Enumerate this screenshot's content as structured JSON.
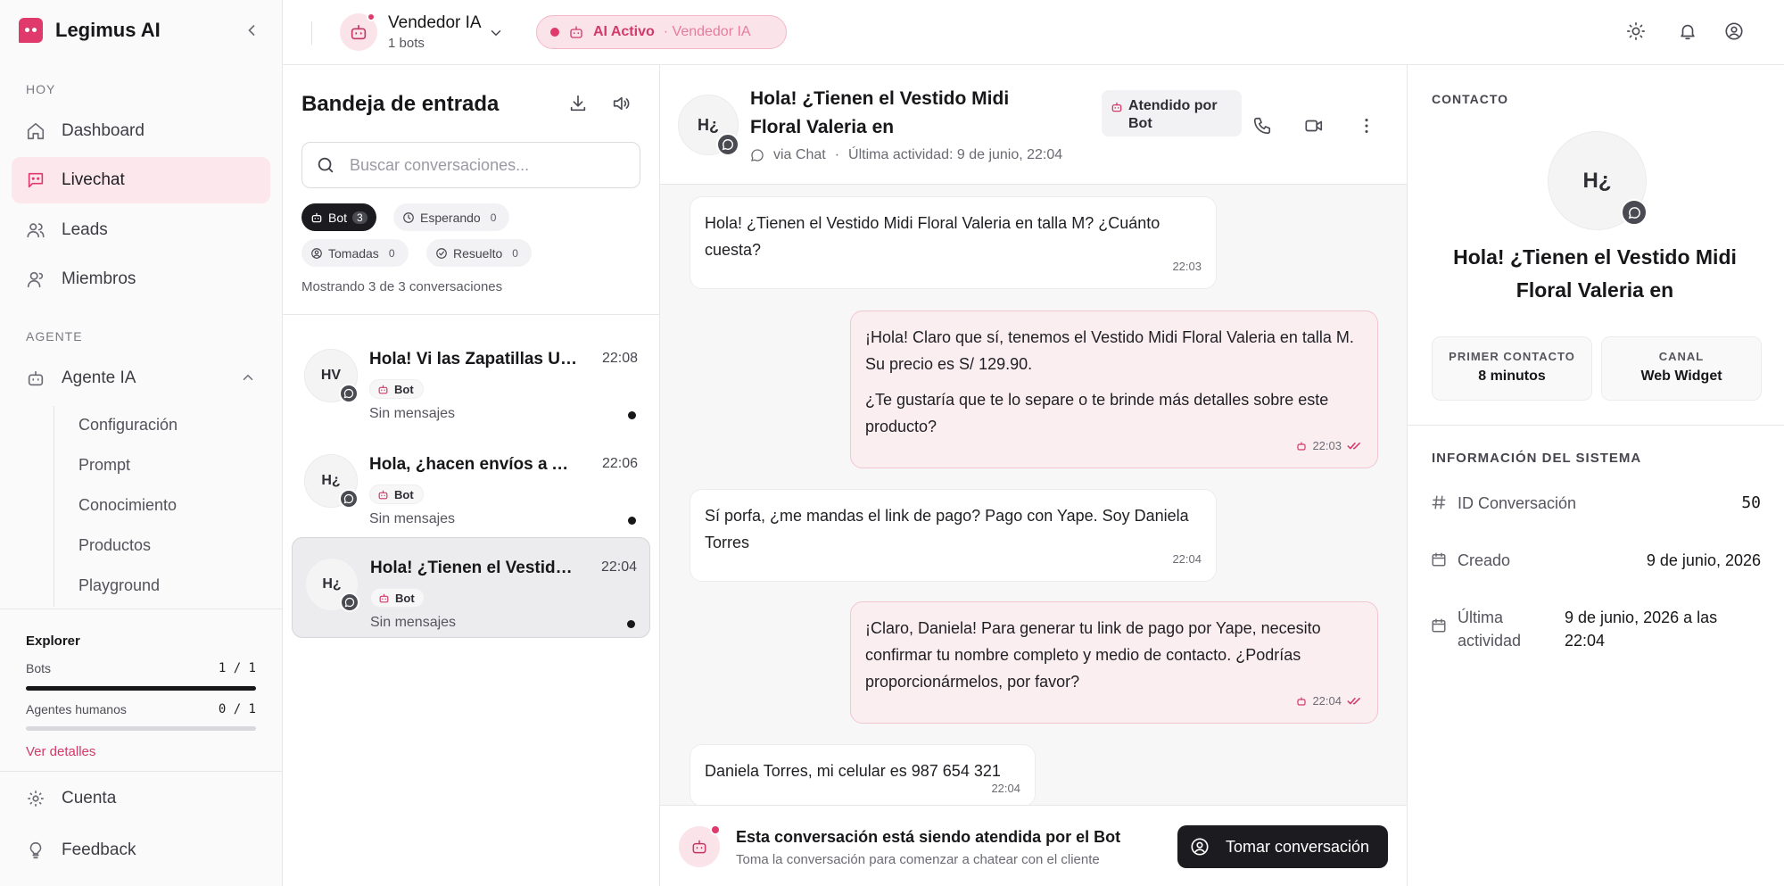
{
  "app": {
    "name": "Legimus AI"
  },
  "sidebar": {
    "section_today": "HOY",
    "nav": [
      {
        "label": "Dashboard",
        "icon": "home-icon"
      },
      {
        "label": "Livechat",
        "icon": "chat-icon",
        "active": true
      },
      {
        "label": "Leads",
        "icon": "users-icon"
      },
      {
        "label": "Miembros",
        "icon": "members-icon"
      }
    ],
    "section_agent": "AGENTE",
    "agent_label": "Agente IA",
    "agent_sub": [
      "Configuración",
      "Prompt",
      "Conocimiento",
      "Productos",
      "Playground"
    ],
    "explorer": {
      "title": "Explorer",
      "bots_label": "Bots",
      "bots_value": "1 / 1",
      "bots_fill": 1.0,
      "humans_label": "Agentes humanos",
      "humans_value": "0 / 1",
      "humans_fill": 0.0,
      "details_link": "Ver detalles"
    },
    "account": "Cuenta",
    "feedback": "Feedback"
  },
  "topbar": {
    "bot_name": "Vendedor IA",
    "bot_count": "1 bots",
    "ai_status": "AI Activo",
    "ai_status_sub": "· Vendedor IA"
  },
  "inbox": {
    "title": "Bandeja de entrada",
    "search_placeholder": "Buscar conversaciones...",
    "filters": [
      {
        "label": "Bot",
        "count": "3",
        "active": true
      },
      {
        "label": "Esperando",
        "count": "0"
      },
      {
        "label": "Tomadas",
        "count": "0"
      },
      {
        "label": "Resuelto",
        "count": "0"
      }
    ],
    "showing": "Mostrando 3 de 3 conversaciones",
    "conversations": [
      {
        "initials": "HV",
        "title": "Hola! Vi las Zapatillas Urbanas",
        "time": "22:08",
        "tag": "Bot",
        "preview": "Sin mensajes"
      },
      {
        "initials": "H¿",
        "title": "Hola, ¿hacen envíos a Arequipa?",
        "time": "22:06",
        "tag": "Bot",
        "preview": "Sin mensajes"
      },
      {
        "initials": "H¿",
        "title": "Hola! ¿Tienen el Vestido Midi",
        "time": "22:04",
        "tag": "Bot",
        "preview": "Sin mensajes",
        "selected": true
      }
    ]
  },
  "chat": {
    "initials": "H¿",
    "title": "Hola! ¿Tienen el Vestido Midi Floral Valeria en",
    "channel": "via Chat",
    "last_activity": "Última actividad: 9 de junio, 22:04",
    "attended_by": "Atendido por Bot",
    "messages": [
      {
        "dir": "in",
        "paras": [
          "Hola! ¿Tienen el Vestido Midi Floral Valeria en talla M? ¿Cuánto cuesta?"
        ],
        "time": "22:03"
      },
      {
        "dir": "out",
        "paras": [
          "¡Hola! Claro que sí, tenemos el Vestido Midi Floral Valeria en talla M. Su precio es S/ 129.90.",
          "¿Te gustaría que te lo separe o te brinde más detalles sobre este producto?"
        ],
        "time": "22:03"
      },
      {
        "dir": "in",
        "paras": [
          "Sí porfa, ¿me mandas el link de pago? Pago con Yape. Soy Daniela Torres"
        ],
        "time": "22:04"
      },
      {
        "dir": "out",
        "paras": [
          "¡Claro, Daniela! Para generar tu link de pago por Yape, necesito confirmar tu nombre completo y medio de contacto. ¿Podrías proporcionármelos, por favor?"
        ],
        "time": "22:04"
      },
      {
        "dir": "in",
        "paras": [
          "Daniela Torres, mi celular es 987 654 321"
        ],
        "time": "22:04"
      }
    ],
    "footer_title": "Esta conversación está siendo atendida por el Bot",
    "footer_sub": "Toma la conversación para comenzar a chatear con el cliente",
    "take_button": "Tomar conversación"
  },
  "contact": {
    "section": "CONTACTO",
    "initials": "H¿",
    "name": "Hola! ¿Tienen el Vestido Midi Floral Valeria en",
    "first_contact_label": "PRIMER CONTACTO",
    "first_contact_value": "8 minutos",
    "channel_label": "CANAL",
    "channel_value": "Web Widget",
    "system_section": "INFORMACIÓN DEL SISTEMA",
    "id_label": "ID Conversación",
    "id_value": "50",
    "created_label": "Creado",
    "created_value": "9 de junio, 2026",
    "last_label": "Última actividad",
    "last_value": "9 de junio, 2026 a las 22:04"
  },
  "colors": {
    "accent": "#e0396b",
    "accent_soft": "#fbe7ec",
    "dark": "#1c1c20"
  }
}
